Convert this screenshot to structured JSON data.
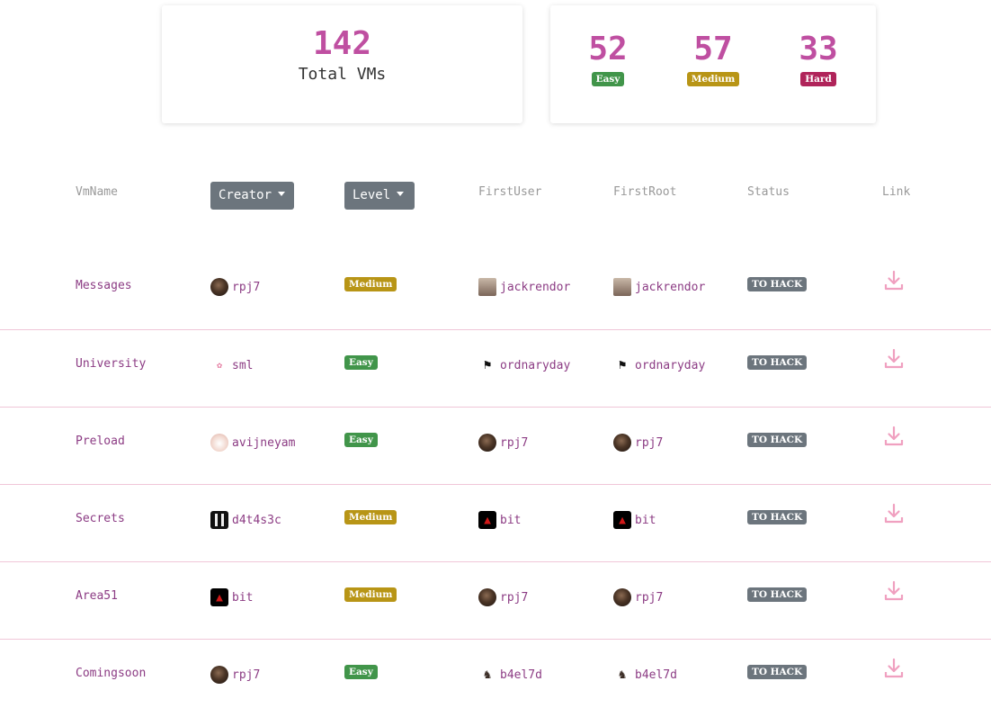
{
  "summary": {
    "total_count": "142",
    "total_label": "Total VMs",
    "levels": [
      {
        "count": "52",
        "label": "Easy",
        "kind": "easy"
      },
      {
        "count": "57",
        "label": "Medium",
        "kind": "medium"
      },
      {
        "count": "33",
        "label": "Hard",
        "kind": "hard"
      }
    ]
  },
  "colors": {
    "accent": "#bf4fa1",
    "link_text": "#8c3c84",
    "easy": "#41954a",
    "medium": "#b89516",
    "hard": "#b0245a",
    "status": "#6c757d",
    "download_icon": "#f0a0c0"
  },
  "table": {
    "headers": {
      "vmname": "VmName",
      "creator": "Creator",
      "level": "Level",
      "firstuser": "FirstUser",
      "firstroot": "FirstRoot",
      "status": "Status",
      "link": "Link"
    },
    "rows": [
      {
        "vm": "Messages",
        "creator": "rpj7",
        "creator_icon": "rpj7-avatar",
        "level": "Medium",
        "level_kind": "medium",
        "firstuser": "jackrendor",
        "firstuser_icon": "jack-avatar",
        "firstroot": "jackrendor",
        "firstroot_icon": "jack-avatar",
        "status": "TO HACK",
        "link_icon": "download-icon"
      },
      {
        "vm": "University",
        "creator": "sml",
        "creator_icon": "sml-avatar",
        "level": "Easy",
        "level_kind": "easy",
        "firstuser": "ordnaryday",
        "firstuser_icon": "flag-avatar",
        "firstroot": "ordnaryday",
        "firstroot_icon": "flag-avatar",
        "status": "TO HACK",
        "link_icon": "download-icon"
      },
      {
        "vm": "Preload",
        "creator": "avijneyam",
        "creator_icon": "avijneyam-avatar",
        "level": "Easy",
        "level_kind": "easy",
        "firstuser": "rpj7",
        "firstuser_icon": "rpj7-avatar",
        "firstroot": "rpj7",
        "firstroot_icon": "rpj7-avatar",
        "status": "TO HACK",
        "link_icon": "download-icon"
      },
      {
        "vm": "Secrets",
        "creator": "d4t4s3c",
        "creator_icon": "d4t4s3c-avatar",
        "level": "Medium",
        "level_kind": "medium",
        "firstuser": "bit",
        "firstuser_icon": "bit-avatar",
        "firstroot": "bit",
        "firstroot_icon": "bit-avatar",
        "status": "TO HACK",
        "link_icon": "download-icon"
      },
      {
        "vm": "Area51",
        "creator": "bit",
        "creator_icon": "bit-avatar",
        "level": "Medium",
        "level_kind": "medium",
        "firstuser": "rpj7",
        "firstuser_icon": "rpj7-avatar",
        "firstroot": "rpj7",
        "firstroot_icon": "rpj7-avatar",
        "status": "TO HACK",
        "link_icon": "download-icon"
      },
      {
        "vm": "Comingsoon",
        "creator": "rpj7",
        "creator_icon": "rpj7-avatar",
        "level": "Easy",
        "level_kind": "easy",
        "firstuser": "b4el7d",
        "firstuser_icon": "b4el7d-avatar",
        "firstroot": "b4el7d",
        "firstroot_icon": "b4el7d-avatar",
        "status": "TO HACK",
        "link_icon": "download-icon"
      }
    ]
  }
}
